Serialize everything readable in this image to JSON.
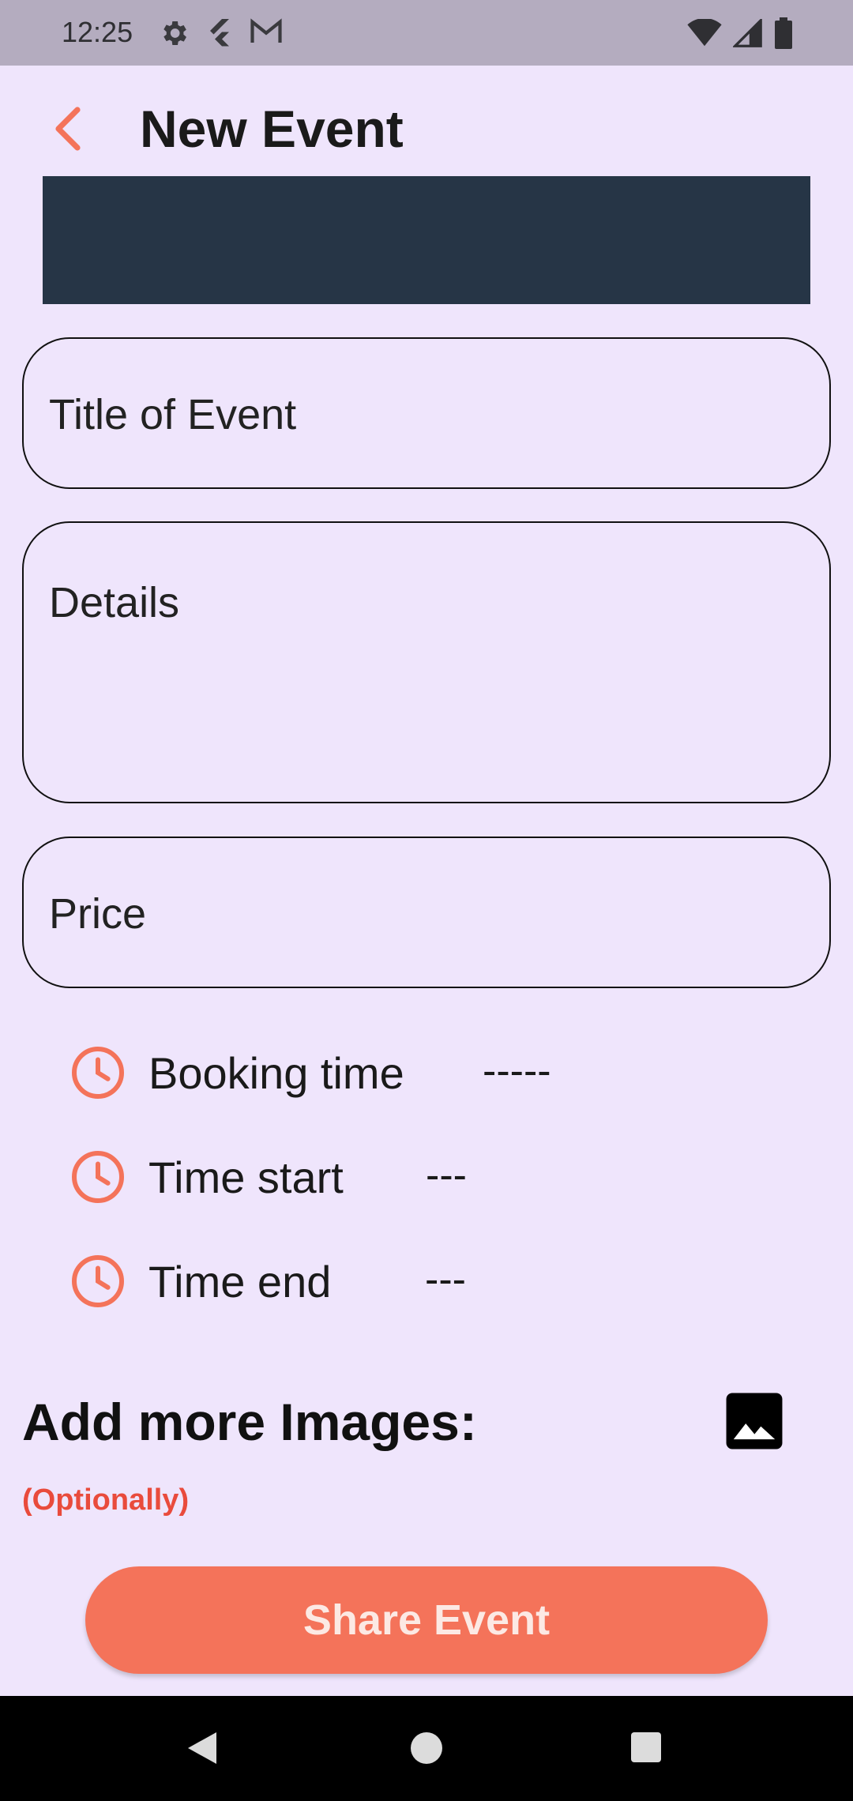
{
  "status_bar": {
    "time": "12:25",
    "left_icons": [
      "gear-icon",
      "flutter-icon",
      "gmail-icon"
    ],
    "right_icons": [
      "wifi-icon",
      "signal-icon",
      "battery-icon"
    ],
    "background": "#B4ACBF"
  },
  "app_bar": {
    "title": "New Event",
    "back_icon": "chevron-left-icon",
    "accent": "#F4735A"
  },
  "form": {
    "title_placeholder": "Title of Event",
    "details_placeholder": "Details",
    "price_placeholder": "Price"
  },
  "times": [
    {
      "label": "Booking time",
      "value": "-----"
    },
    {
      "label": "Time start",
      "value": "---"
    },
    {
      "label": "Time end",
      "value": "---"
    }
  ],
  "images_section": {
    "title": "Add more Images:",
    "note": "(Optionally)",
    "icon": "image-icon"
  },
  "actions": {
    "share_label": "Share Event"
  },
  "colors": {
    "background": "#EFE5FC",
    "banner": "#263546",
    "accent": "#F4735A",
    "note": "#E94B3C"
  }
}
